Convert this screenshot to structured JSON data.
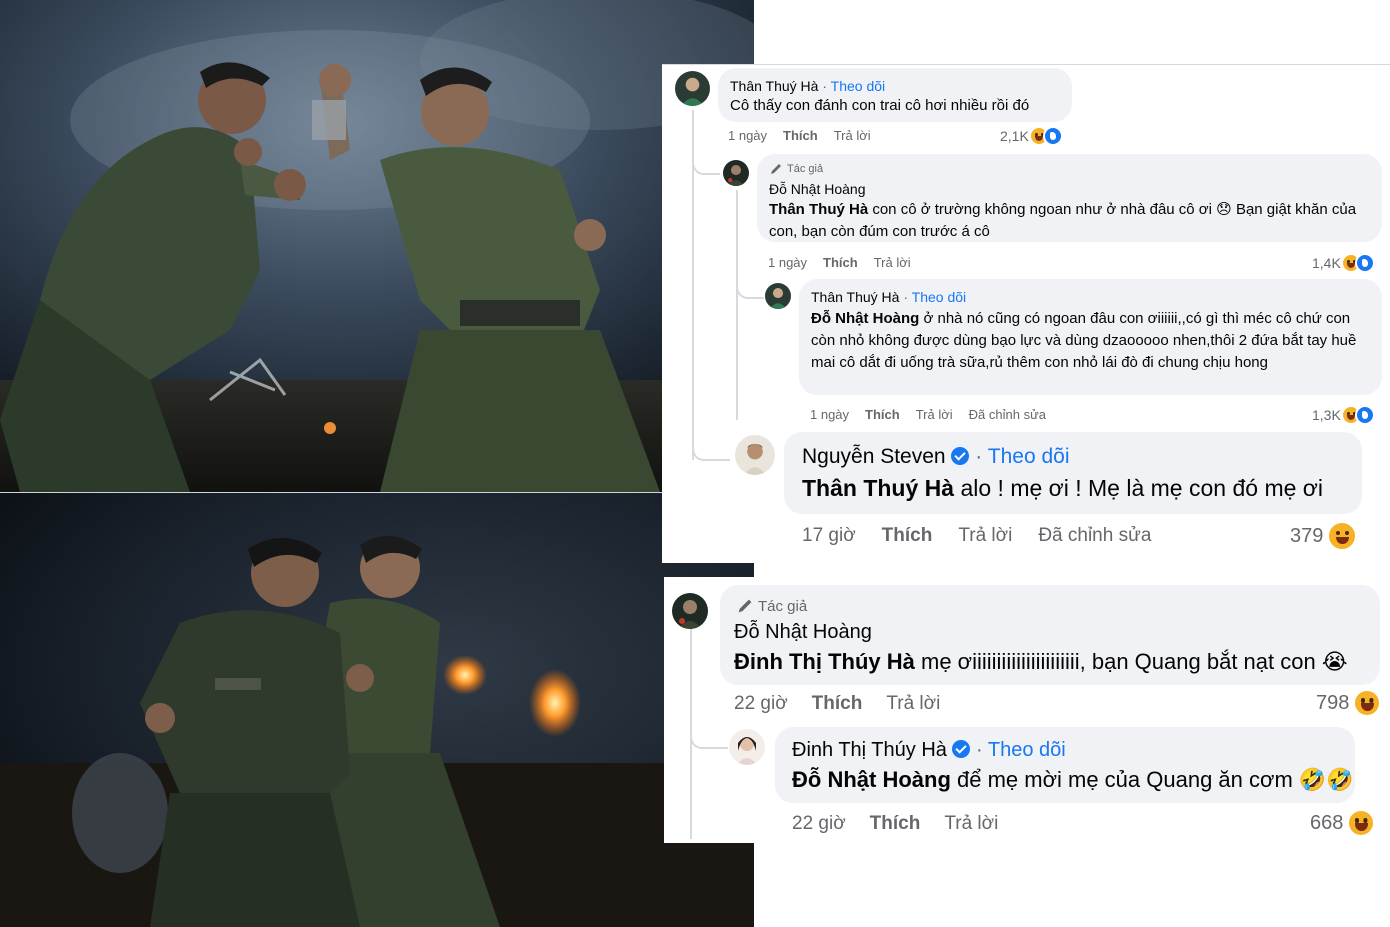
{
  "panel1": {
    "c1": {
      "name": "Thân Thuý Hà",
      "sep": "·",
      "follow": "Theo dõi",
      "text": "Cô thấy con đánh con trai cô hơi nhiều rồi đó",
      "time": "1 ngày",
      "like": "Thích",
      "reply": "Trả lời",
      "reactions": "2,1K"
    },
    "c2": {
      "author_badge": "Tác giả",
      "name": "Đỗ Nhật Hoàng",
      "tag": "Thân Thuý Hà",
      "text": " con cô ở trường không ngoan như ở nhà đâu cô ơi 😞 Bạn giật khăn của con, bạn còn đúm con trước á cô",
      "time": "1 ngày",
      "like": "Thích",
      "reply": "Trả lời",
      "reactions": "1,4K"
    },
    "c3": {
      "name": "Thân Thuý Hà",
      "sep": "·",
      "follow": "Theo dõi",
      "tag": "Đỗ Nhật Hoàng",
      "text": " ở nhà nó cũng có ngoan đâu con ơiiiiii,,có gì thì méc cô chứ con còn nhỏ không được dùng bạo lực và dùng dzaooooo nhen,thôi 2 đứa bắt tay huề mai cô dắt đi uống trà sữa,rủ thêm con nhỏ lái đò đi chung chịu hong",
      "time": "1 ngày",
      "like": "Thích",
      "reply": "Trả lời",
      "edited": "Đã chỉnh sửa",
      "reactions": "1,3K"
    },
    "c4": {
      "name": "Nguyễn Steven",
      "sep": "·",
      "follow": "Theo dõi",
      "tag": "Thân Thuý Hà",
      "text": " alo ! mẹ ơi ! Mẹ là mẹ con đó mẹ ơi",
      "time": "17 giờ",
      "like": "Thích",
      "reply": "Trả lời",
      "edited": "Đã chỉnh sửa",
      "reactions": "379"
    }
  },
  "panel2": {
    "c1": {
      "author_badge": "Tác giả",
      "name": "Đỗ Nhật Hoàng",
      "tag": "Đinh Thị Thúy Hà",
      "text": " mẹ ơiiiiiiiiiiiiiiiiiiiiii, bạn Quang bắt nạt con 😭",
      "time": "22 giờ",
      "like": "Thích",
      "reply": "Trả lời",
      "reactions": "798"
    },
    "c2": {
      "name": "Đinh Thị Thúy Hà",
      "sep": "·",
      "follow": "Theo dõi",
      "tag": "Đỗ Nhật Hoàng",
      "text": " để mẹ mời mẹ của Quang ăn cơm 🤣🤣",
      "time": "22 giờ",
      "like": "Thích",
      "reply": "Trả lời",
      "reactions": "668"
    }
  },
  "colors": {
    "link": "#1877f2",
    "bubble": "#f0f2f5",
    "meta": "#65676b",
    "photo_night": "#1e2a3a"
  }
}
